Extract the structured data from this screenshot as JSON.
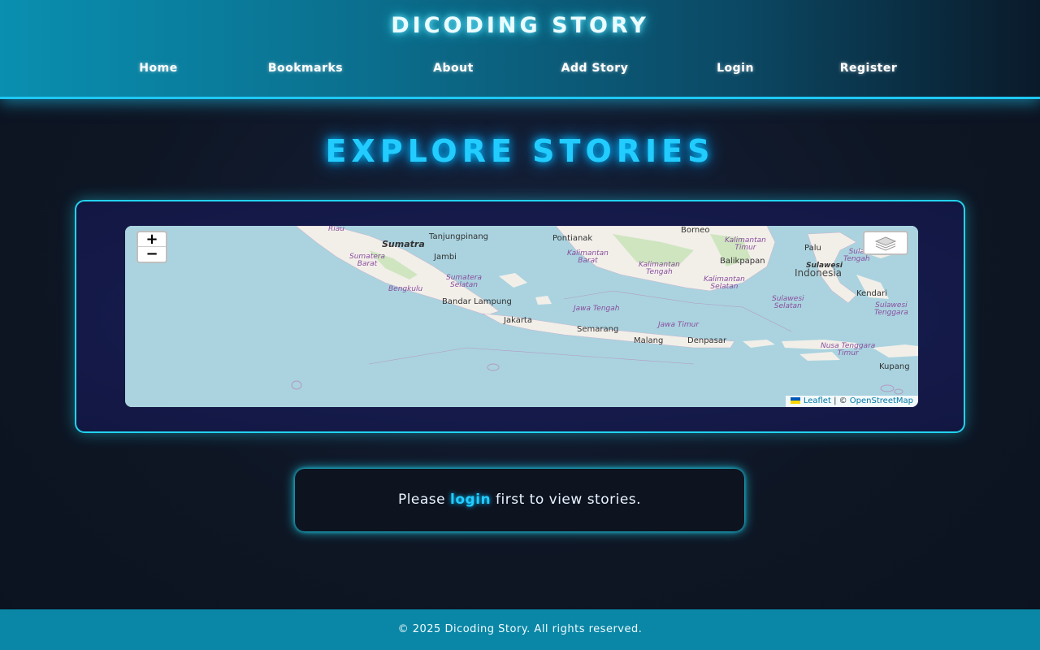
{
  "header": {
    "title": "DICODING STORY",
    "nav": [
      {
        "label": "Home"
      },
      {
        "label": "Bookmarks"
      },
      {
        "label": "About"
      },
      {
        "label": "Add Story"
      },
      {
        "label": "Login"
      },
      {
        "label": "Register"
      }
    ]
  },
  "main": {
    "heading": "EXPLORE STORIES",
    "map": {
      "zoom_in": "+",
      "zoom_out": "−",
      "layers_icon": "layers-icon",
      "attribution": {
        "leaflet": "Leaflet",
        "separator": " | © ",
        "osm": "OpenStreetMap"
      },
      "labels": {
        "riau": "Riau",
        "tanjungpinang": "Tanjungpinang",
        "pontianak": "Pontianak",
        "borneo": "Borneo",
        "sumatra": "Sumatra",
        "jambi": "Jambi",
        "sumatera_barat": "Sumatera\nBarat",
        "sumatera_selatan": "Sumatera\nSelatan",
        "bengkulu": "Bengkulu",
        "bandar_lampung": "Bandar Lampung",
        "jakarta": "Jakarta",
        "semarang": "Semarang",
        "malang": "Malang",
        "denpasar": "Denpasar",
        "jawa_tengah": "Jawa Tengah",
        "jawa_timur": "Jawa Timur",
        "kalimantan_barat": "Kalimantan\nBarat",
        "kalimantan_tengah": "Kalimantan\nTengah",
        "kalimantan_selatan": "Kalimantan\nSelatan",
        "kalimantan_timur": "Kalimantan\nTimur",
        "balikpapan": "Balikpapan",
        "palu": "Palu",
        "sulawesi": "Sulawesi",
        "indonesia": "Indonesia",
        "sulawesi_tengah": "Sula\nTengah",
        "sulawesi_selatan": "Sulawesi\nSelatan",
        "sulawesi_tenggara": "Sulawesi\nTenggara",
        "kendari": "Kendari",
        "nusa_tenggara_timur": "Nusa Tenggara\nTimur",
        "kupang": "Kupang"
      }
    },
    "login_prompt": {
      "before": "Please ",
      "link": "login",
      "after": " first to view stories."
    }
  },
  "footer": {
    "text": "© 2025 Dicoding Story. All rights reserved."
  },
  "colors": {
    "accent": "#22ccff",
    "header_start": "#0a8fb0",
    "footer": "#0a87a6",
    "sea": "#aad3df",
    "land": "#f2efe9"
  }
}
